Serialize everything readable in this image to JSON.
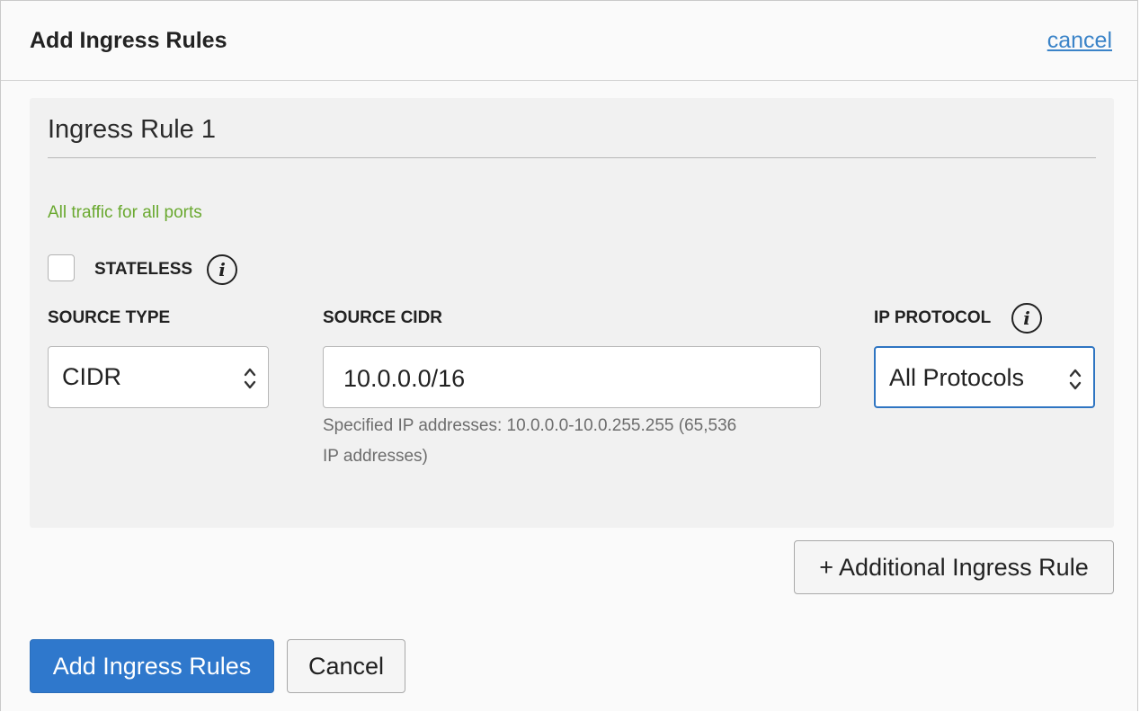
{
  "header": {
    "title": "Add Ingress Rules",
    "cancel_link": "cancel"
  },
  "rule": {
    "title": "Ingress Rule 1",
    "description": "All traffic for all ports",
    "stateless": {
      "label": "STATELESS",
      "checked": false,
      "info_icon": "info-icon"
    },
    "source_type": {
      "label": "SOURCE TYPE",
      "value": "CIDR"
    },
    "source_cidr": {
      "label": "SOURCE CIDR",
      "value": "10.0.0.0/16",
      "help_line1": "Specified IP addresses: 10.0.0.0-10.0.255.255 (65,536",
      "help_line2": "IP addresses)"
    },
    "ip_protocol": {
      "label": "IP PROTOCOL",
      "value": "All Protocols",
      "info_icon": "info-icon"
    }
  },
  "buttons": {
    "additional_rule": "+ Additional Ingress Rule",
    "submit": "Add Ingress Rules",
    "cancel": "Cancel"
  },
  "colors": {
    "primary": "#2f78cc",
    "link": "#3a83c8",
    "success_text": "#6aa930",
    "panel_bg": "#f1f1f1",
    "focus_border": "#2f75c2"
  }
}
